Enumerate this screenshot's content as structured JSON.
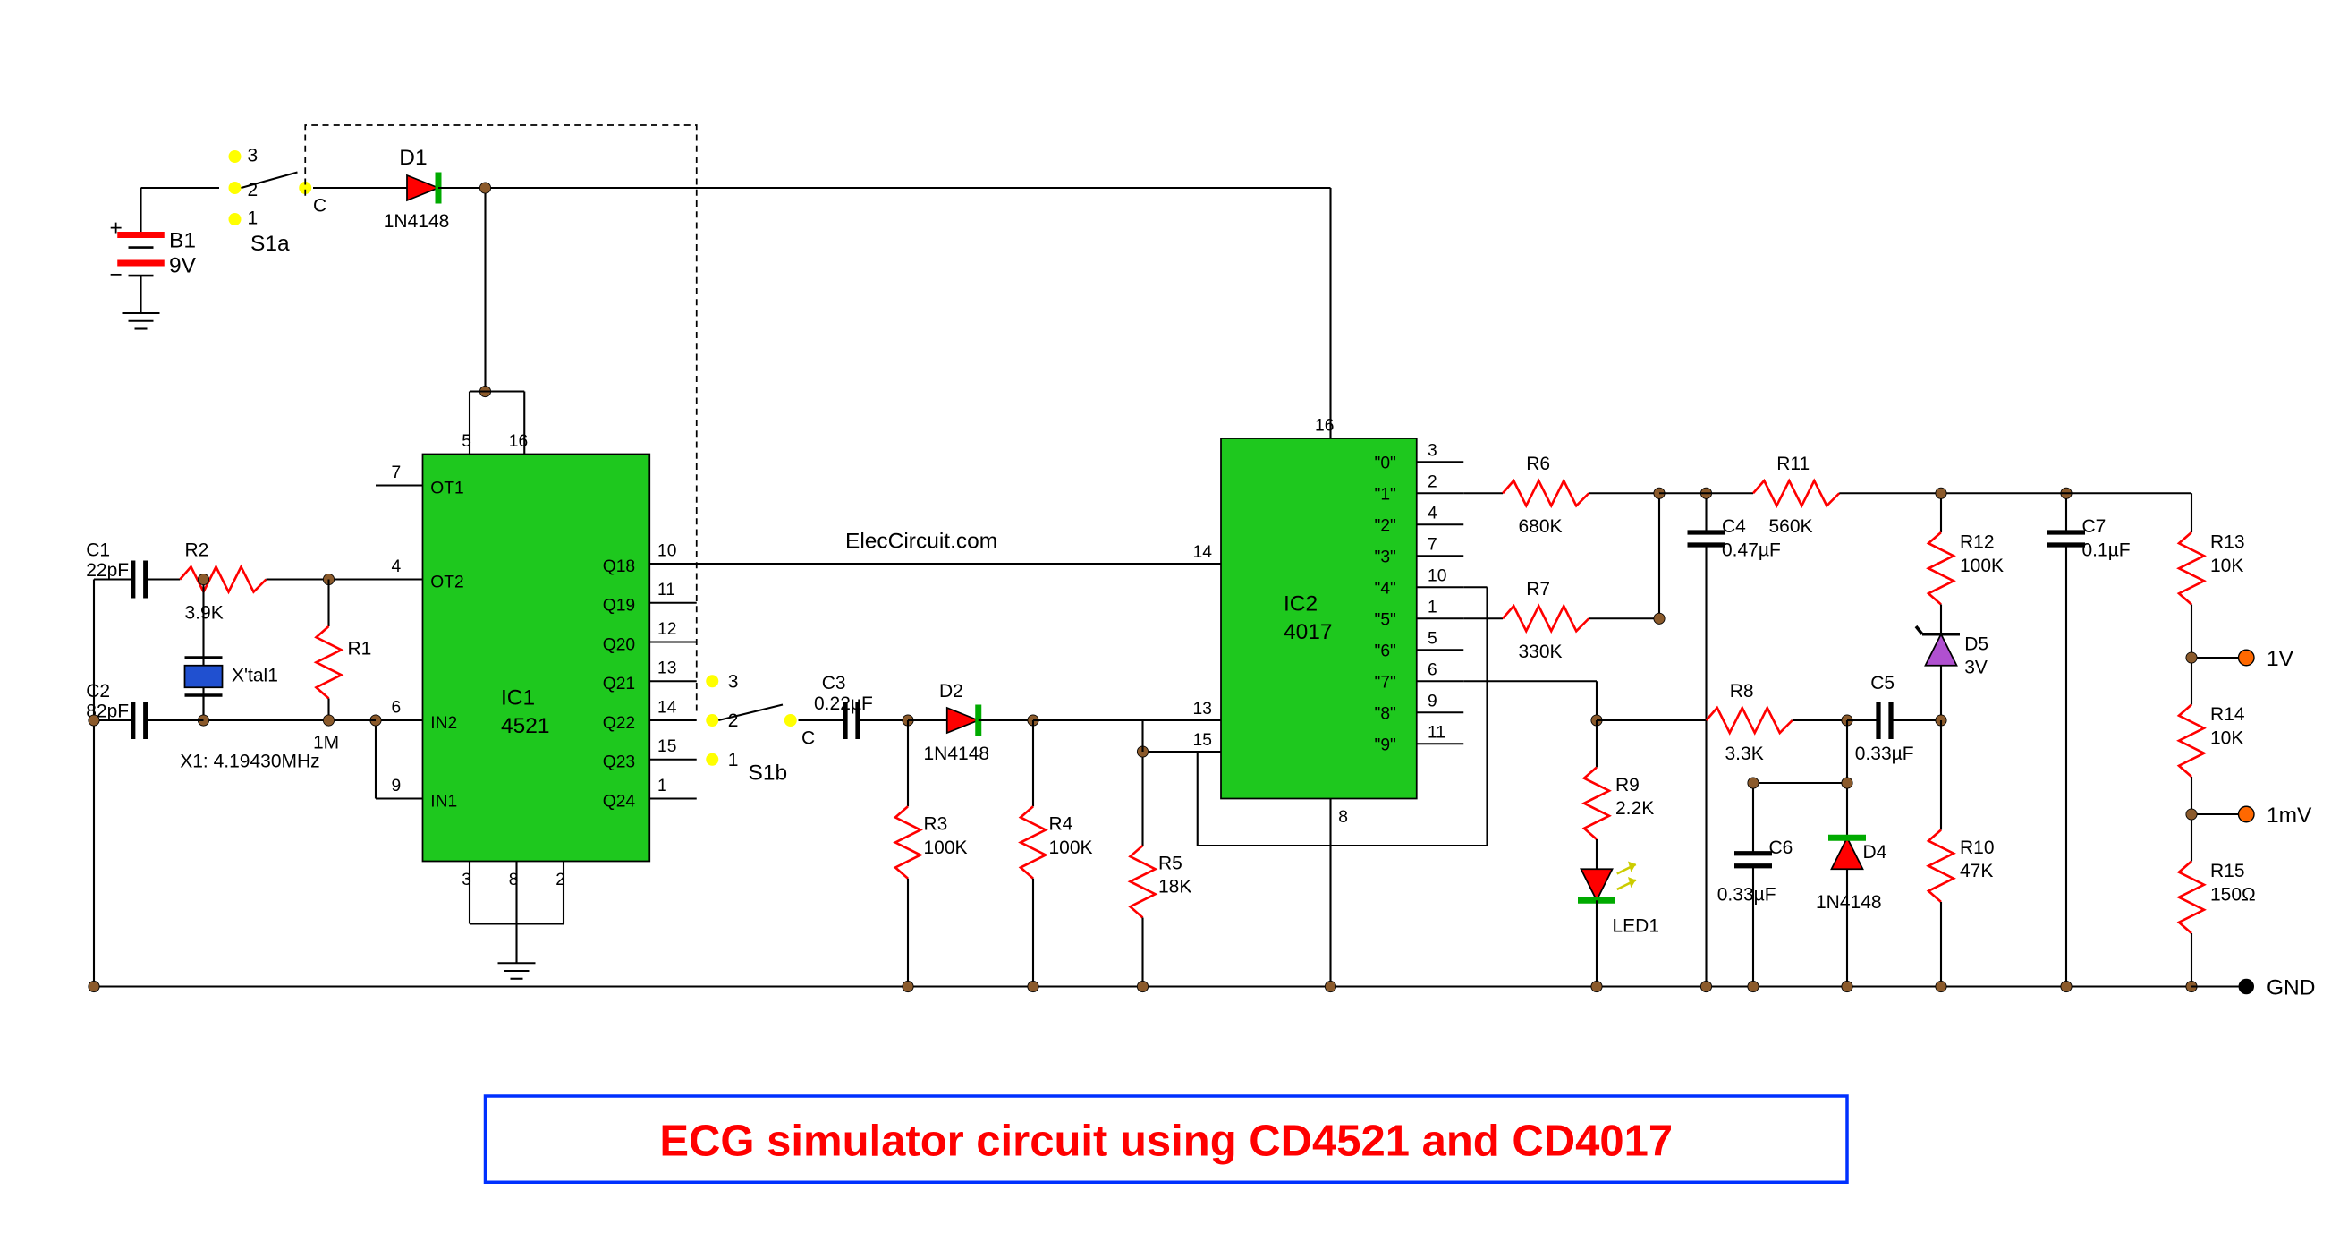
{
  "title": "ECG simulator circuit using CD4521 and CD4017",
  "source": "ElecCircuit.com",
  "battery": {
    "ref": "B1",
    "val": "9V"
  },
  "switches": {
    "s1a": "S1a",
    "s1b": "S1b"
  },
  "crystal": {
    "ref": "X'tal1",
    "freq": "X1: 4.19430MHz"
  },
  "ics": {
    "ic1": {
      "ref": "IC1",
      "part": "4521",
      "pins_left": [
        {
          "num": "7",
          "name": "OT1"
        },
        {
          "num": "4",
          "name": "OT2"
        },
        {
          "num": "6",
          "name": "IN2"
        },
        {
          "num": "9",
          "name": "IN1"
        }
      ],
      "pins_right": [
        {
          "num": "10",
          "name": "Q18"
        },
        {
          "num": "11",
          "name": "Q19"
        },
        {
          "num": "12",
          "name": "Q20"
        },
        {
          "num": "13",
          "name": "Q21"
        },
        {
          "num": "14",
          "name": "Q22"
        },
        {
          "num": "15",
          "name": "Q23"
        },
        {
          "num": "1",
          "name": "Q24"
        }
      ],
      "pins_top": [
        {
          "num": "5"
        },
        {
          "num": "16"
        }
      ],
      "pins_bot": [
        {
          "num": "3"
        },
        {
          "num": "8"
        },
        {
          "num": "2"
        }
      ]
    },
    "ic2": {
      "ref": "IC2",
      "part": "4017",
      "pins_left": [
        {
          "num": "14"
        },
        {
          "num": "13"
        },
        {
          "num": "15"
        }
      ],
      "pins_right": [
        {
          "num": "3",
          "name": "\"0\""
        },
        {
          "num": "2",
          "name": "\"1\""
        },
        {
          "num": "4",
          "name": "\"2\""
        },
        {
          "num": "7",
          "name": "\"3\""
        },
        {
          "num": "10",
          "name": "\"4\""
        },
        {
          "num": "1",
          "name": "\"5\""
        },
        {
          "num": "5",
          "name": "\"6\""
        },
        {
          "num": "6",
          "name": "\"7\""
        },
        {
          "num": "9",
          "name": "\"8\""
        },
        {
          "num": "11",
          "name": "\"9\""
        }
      ],
      "pin_top": "16",
      "pin_bot": "8"
    }
  },
  "caps": {
    "c1": {
      "ref": "C1",
      "val": "22pF"
    },
    "c2": {
      "ref": "C2",
      "val": "82pF"
    },
    "c3": {
      "ref": "C3",
      "val": "0.22µF"
    },
    "c4": {
      "ref": "C4",
      "val": "0.47µF"
    },
    "c5": {
      "ref": "C5",
      "val": "0.33µF"
    },
    "c6": {
      "ref": "C6",
      "val": "0.33µF"
    },
    "c7": {
      "ref": "C7",
      "val": "0.1µF"
    }
  },
  "res": {
    "r1": {
      "ref": "R1",
      "val": "1M"
    },
    "r2": {
      "ref": "R2",
      "val": "3.9K"
    },
    "r3": {
      "ref": "R3",
      "val": "100K"
    },
    "r4": {
      "ref": "R4",
      "val": "100K"
    },
    "r5": {
      "ref": "R5",
      "val": "18K"
    },
    "r6": {
      "ref": "R6",
      "val": "680K"
    },
    "r7": {
      "ref": "R7",
      "val": "330K"
    },
    "r8": {
      "ref": "R8",
      "val": "3.3K"
    },
    "r9": {
      "ref": "R9",
      "val": "2.2K"
    },
    "r10": {
      "ref": "R10",
      "val": "47K"
    },
    "r11": {
      "ref": "R11",
      "val": "560K"
    },
    "r12": {
      "ref": "R12",
      "val": "100K"
    },
    "r13": {
      "ref": "R13",
      "val": "10K"
    },
    "r14": {
      "ref": "R14",
      "val": "10K"
    },
    "r15": {
      "ref": "R15",
      "val": "150Ω"
    }
  },
  "diodes": {
    "d1": {
      "ref": "D1",
      "val": "1N4148"
    },
    "d2": {
      "ref": "D2",
      "val": "1N4148"
    },
    "d4": {
      "ref": "D4",
      "val": "1N4148"
    },
    "d5": {
      "ref": "D5",
      "val": "3V"
    },
    "led1": {
      "ref": "LED1"
    }
  },
  "outputs": {
    "o1": "1V",
    "o2": "1mV",
    "gnd": "GND"
  },
  "switch_terminals": {
    "t1": "1",
    "t2": "2",
    "t3": "3",
    "c": "C"
  }
}
